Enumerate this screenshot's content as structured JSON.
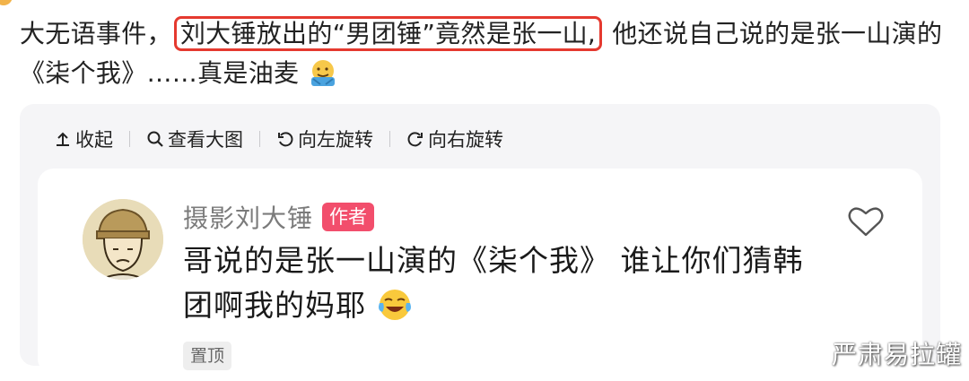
{
  "post": {
    "text_before": "大无语事件，",
    "highlighted_text": "刘大锤放出的“男团锤”竟然是张一山,",
    "text_after": " 他还说自己说的是张一山演的《柒个我》……真是油麦"
  },
  "toolbar": {
    "items": [
      {
        "label": "收起",
        "icon": "collapse-up-arrow-icon"
      },
      {
        "label": "查看大图",
        "icon": "magnify-icon"
      },
      {
        "label": "向左旋转",
        "icon": "rotate-left-icon"
      },
      {
        "label": "向右旋转",
        "icon": "rotate-right-icon"
      }
    ]
  },
  "comment": {
    "author": "摄影刘大锤",
    "badge": "作者",
    "text": "哥说的是张一山演的《柒个我》 谁让你们猜韩团啊我的妈耶",
    "pinned_label": "置顶"
  },
  "watermark": "严肃易拉罐",
  "colors": {
    "highlight_border": "#e5392f",
    "badge_bg": "#f24e6c",
    "card_bg": "#f5f5f7"
  }
}
